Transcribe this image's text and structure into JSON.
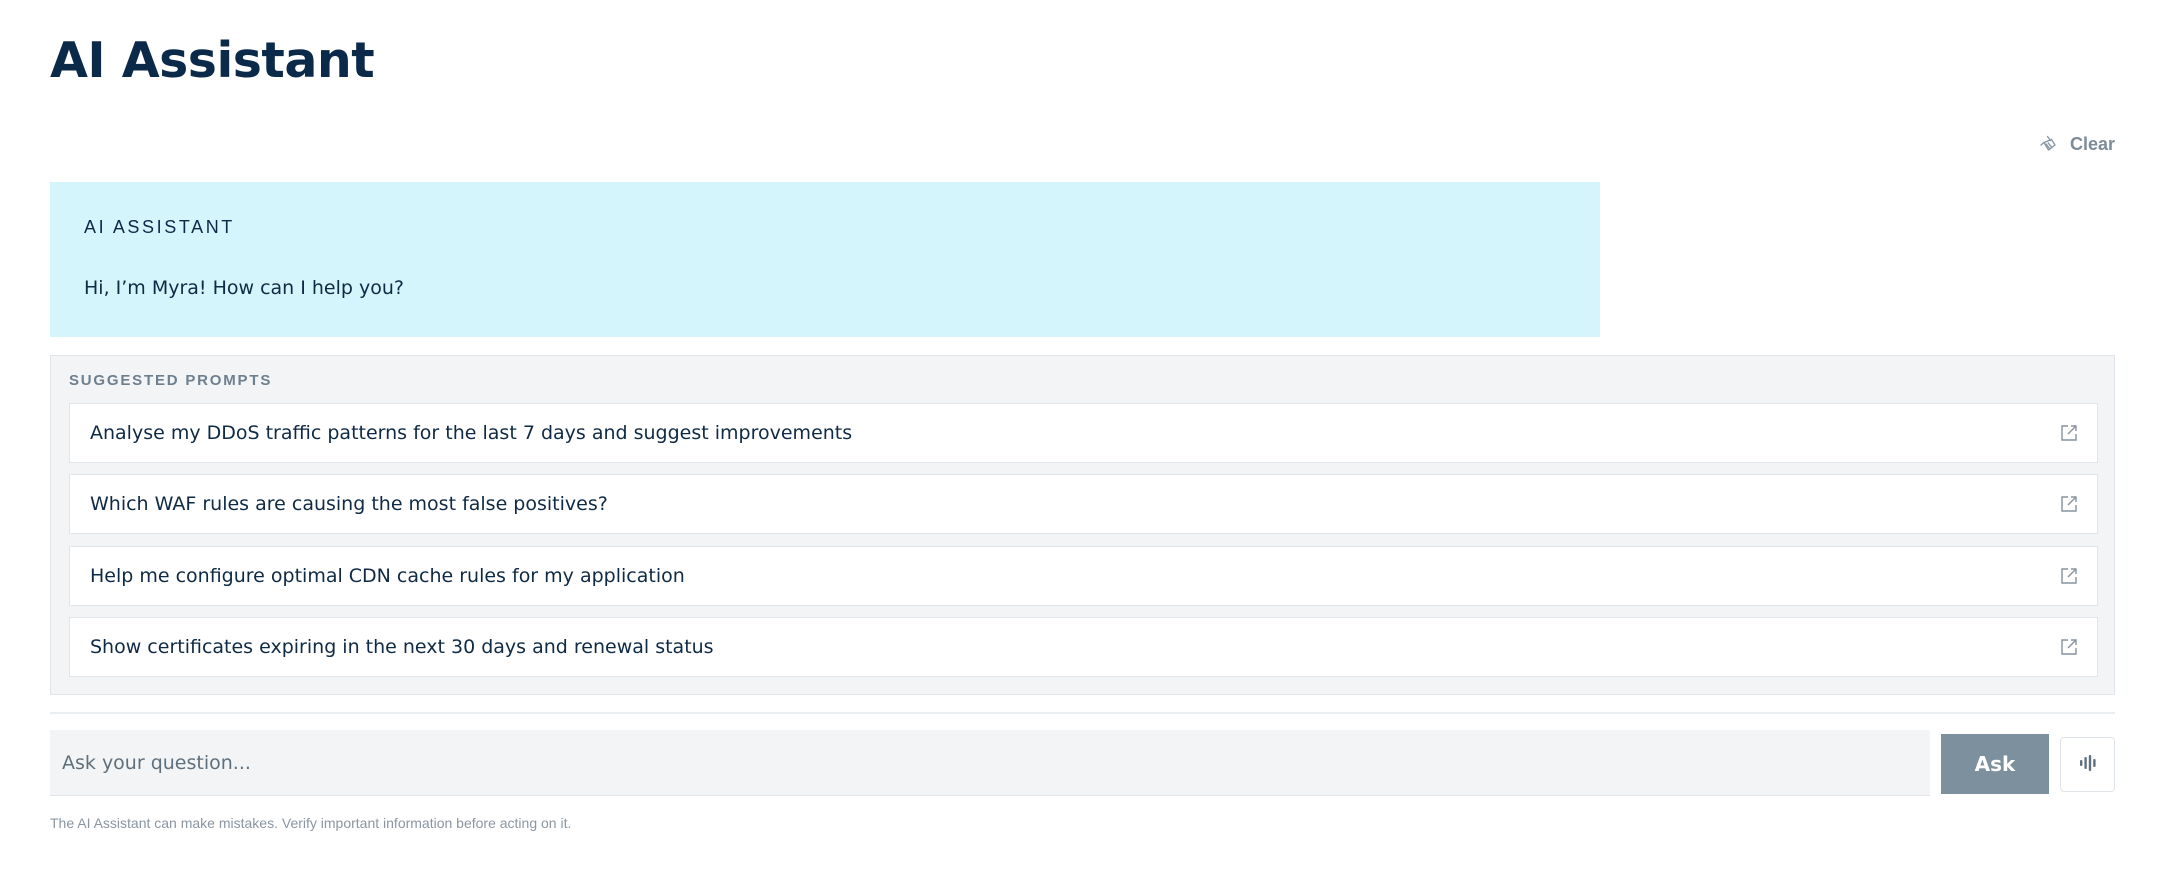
{
  "page": {
    "title": "AI Assistant"
  },
  "toolbar": {
    "clear_label": "Clear",
    "clear_icon": "broom-icon"
  },
  "conversation": {
    "assistant_label": "AI ASSISTANT",
    "greeting": "Hi, I’m Myra! How can I help you?"
  },
  "suggested_prompts": {
    "heading": "SUGGESTED PROMPTS",
    "items": [
      {
        "text": "Analyse my DDoS traffic patterns for the last 7 days and suggest improvements",
        "icon": "external-link-icon"
      },
      {
        "text": "Which WAF rules are causing the most false positives?",
        "icon": "external-link-icon"
      },
      {
        "text": "Help me configure optimal CDN cache rules for my application",
        "icon": "external-link-icon"
      },
      {
        "text": "Show certificates expiring in the next 30 days and renewal status",
        "icon": "external-link-icon"
      }
    ]
  },
  "composer": {
    "placeholder": "Ask your question...",
    "value": "",
    "ask_label": "Ask",
    "voice_icon": "voice-waveform-icon"
  },
  "footer": {
    "disclaimer": "The AI Assistant can make mistakes. Verify important information before acting on it."
  },
  "colors": {
    "title": "#0b2a4a",
    "assistant_bubble": "#d4f5fc",
    "panel_background": "#f2f4f6",
    "ask_button": "#7c909e",
    "muted_text": "#7c8c99"
  }
}
